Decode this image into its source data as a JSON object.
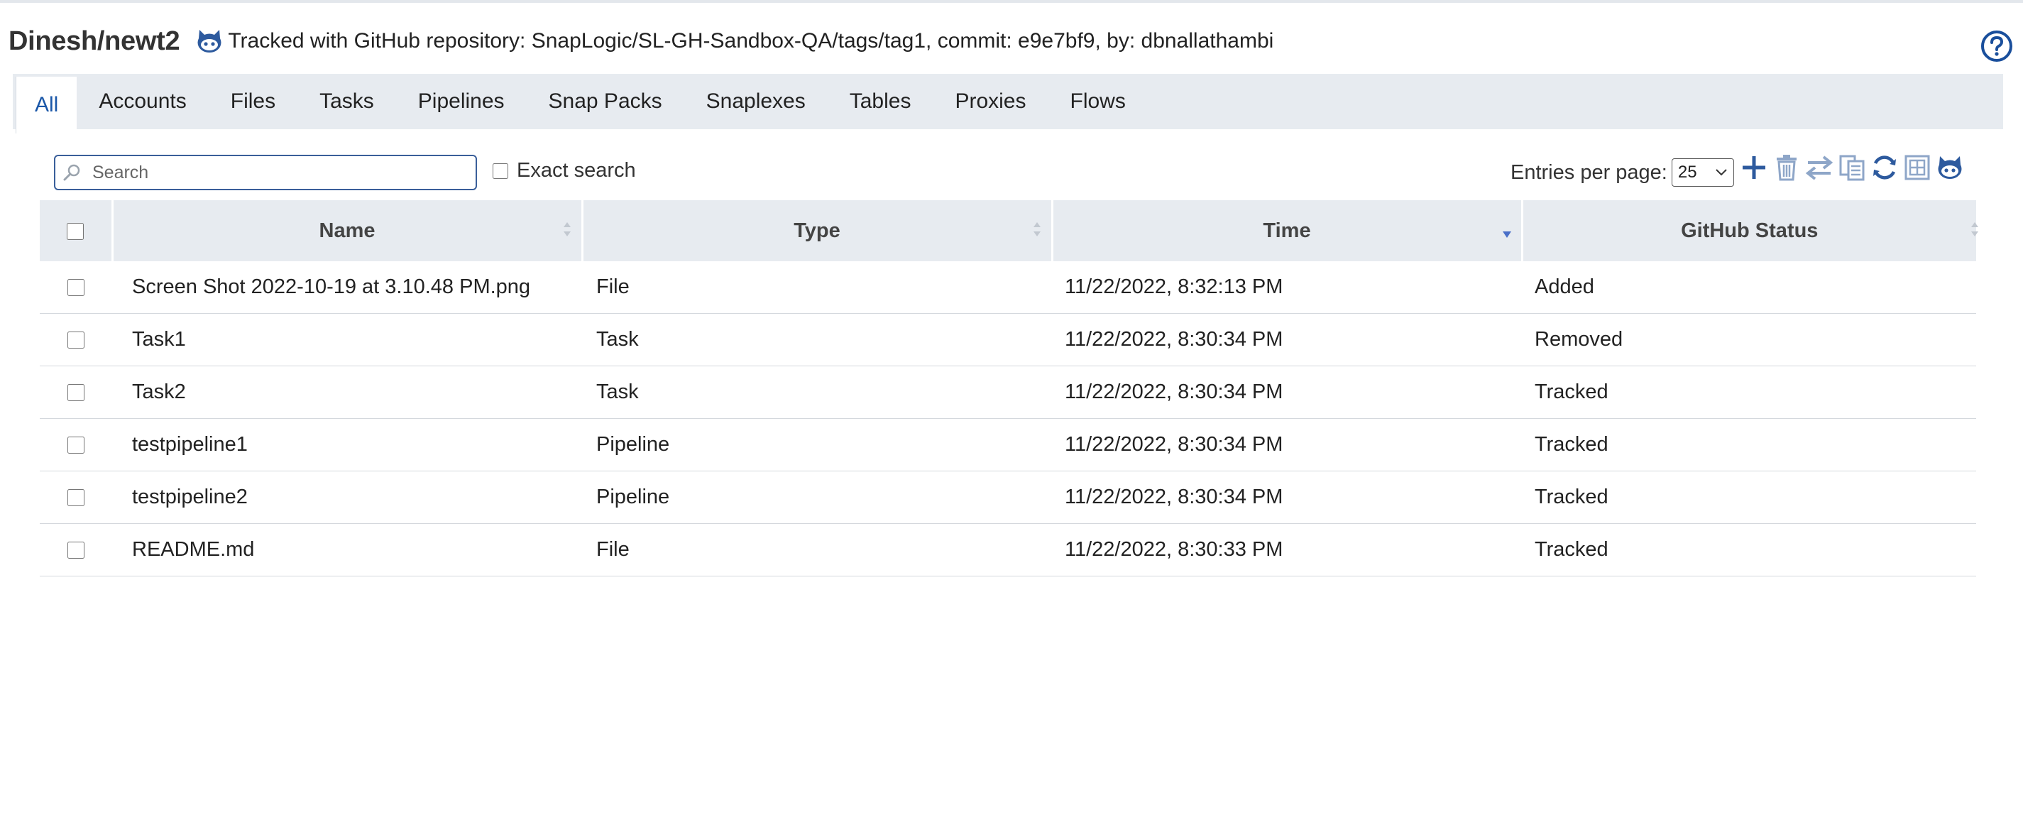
{
  "header": {
    "project": "Dinesh/newt2",
    "tracked_text": "Tracked with GitHub repository: SnapLogic/SL-GH-Sandbox-QA/tags/tag1, commit: e9e7bf9, by: dbnallathambi"
  },
  "help_icon": "question-circle-icon",
  "tabs": [
    {
      "label": "All",
      "active": true
    },
    {
      "label": "Accounts",
      "active": false
    },
    {
      "label": "Files",
      "active": false
    },
    {
      "label": "Tasks",
      "active": false
    },
    {
      "label": "Pipelines",
      "active": false
    },
    {
      "label": "Snap Packs",
      "active": false
    },
    {
      "label": "Snaplexes",
      "active": false
    },
    {
      "label": "Tables",
      "active": false
    },
    {
      "label": "Proxies",
      "active": false
    },
    {
      "label": "Flows",
      "active": false
    }
  ],
  "search": {
    "placeholder": "Search",
    "value": ""
  },
  "exact_search": {
    "label": "Exact search",
    "checked": false
  },
  "entries_per_page": {
    "label": "Entries per page:",
    "value": "25"
  },
  "actions": [
    "add-icon",
    "delete-icon",
    "move-icon",
    "copy-icon",
    "refresh-icon",
    "expand-icon",
    "github-icon"
  ],
  "table": {
    "columns": [
      "Name",
      "Type",
      "Time",
      "GitHub Status"
    ],
    "sorted_column": "Time",
    "rows": [
      {
        "name": "Screen Shot 2022-10-19 at 3.10.48 PM.png",
        "type": "File",
        "time": "11/22/2022, 8:32:13 PM",
        "status": "Added"
      },
      {
        "name": "Task1",
        "type": "Task",
        "time": "11/22/2022, 8:30:34 PM",
        "status": "Removed"
      },
      {
        "name": "Task2",
        "type": "Task",
        "time": "11/22/2022, 8:30:34 PM",
        "status": "Tracked"
      },
      {
        "name": "testpipeline1",
        "type": "Pipeline",
        "time": "11/22/2022, 8:30:34 PM",
        "status": "Tracked"
      },
      {
        "name": "testpipeline2",
        "type": "Pipeline",
        "time": "11/22/2022, 8:30:34 PM",
        "status": "Tracked"
      },
      {
        "name": "README.md",
        "type": "File",
        "time": "11/22/2022, 8:30:33 PM",
        "status": "Tracked"
      }
    ]
  },
  "colors": {
    "accent": "#1a57a8",
    "tab_bar": "#e7ebf0",
    "icon_blue": "#2d5a9e",
    "icon_light": "#8ea6c8"
  }
}
